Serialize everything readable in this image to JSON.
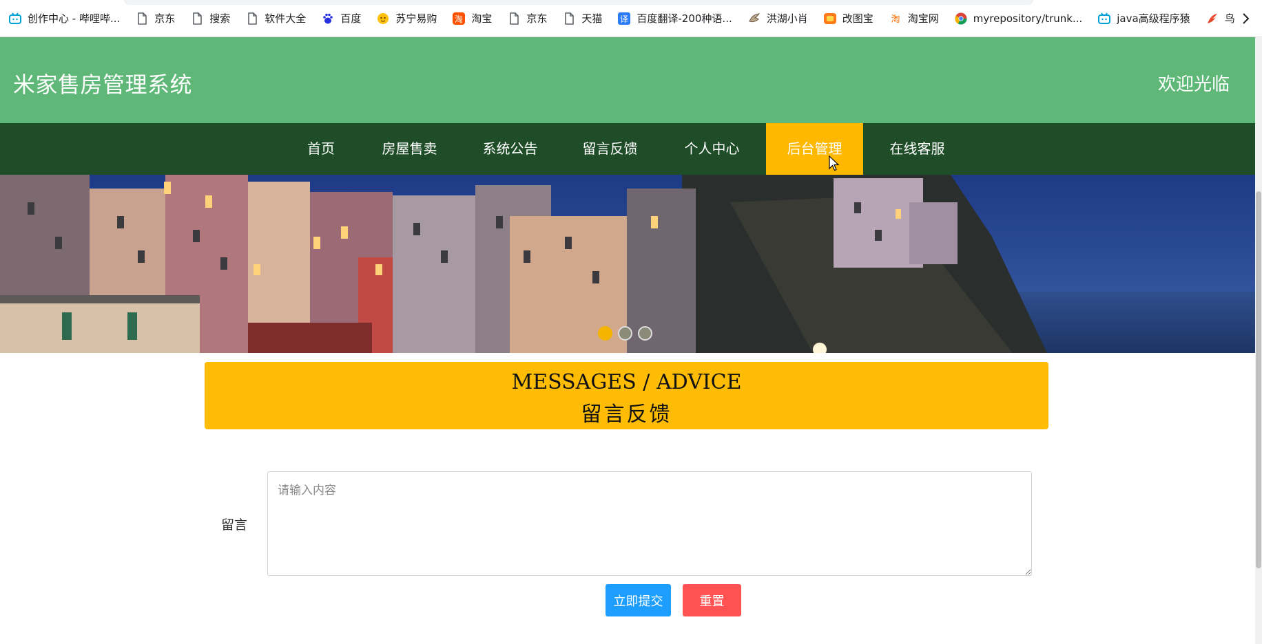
{
  "bookmarks": [
    {
      "label": "创作中心 - 哔哩哔...",
      "icon": "bilibili-icon"
    },
    {
      "label": "京东",
      "icon": "page-icon"
    },
    {
      "label": "搜索",
      "icon": "page-icon"
    },
    {
      "label": "软件大全",
      "icon": "page-icon"
    },
    {
      "label": "百度",
      "icon": "baidu-icon"
    },
    {
      "label": "苏宁易购",
      "icon": "suning-icon"
    },
    {
      "label": "淘宝",
      "icon": "taobao-icon"
    },
    {
      "label": "京东",
      "icon": "page-icon"
    },
    {
      "label": "天猫",
      "icon": "page-icon"
    },
    {
      "label": "百度翻译-200种语...",
      "icon": "translate-icon"
    },
    {
      "label": "洪湖小肖",
      "icon": "bird-icon"
    },
    {
      "label": "改图宝",
      "icon": "gaitubao-icon"
    },
    {
      "label": "淘宝网",
      "icon": "taobao-icon"
    },
    {
      "label": "myrepository/trunk...",
      "icon": "chrome-icon"
    },
    {
      "label": "java高级程序猿",
      "icon": "bilibili-icon"
    },
    {
      "label": "鸟",
      "icon": "feather-icon"
    }
  ],
  "header": {
    "title": "米家售房管理系统",
    "welcome": "欢迎光临"
  },
  "nav": [
    {
      "label": "首页",
      "active": false
    },
    {
      "label": "房屋售卖",
      "active": false
    },
    {
      "label": "系统公告",
      "active": false
    },
    {
      "label": "留言反馈",
      "active": false
    },
    {
      "label": "个人中心",
      "active": false
    },
    {
      "label": "后台管理",
      "active": true
    },
    {
      "label": "在线客服",
      "active": false
    }
  ],
  "banner": {
    "active_slide": 1,
    "slide_count": 3
  },
  "section": {
    "title_en": "MESSAGES / ADVICE",
    "title_cn": "留言反馈"
  },
  "form": {
    "label": "留言",
    "value": "",
    "placeholder": "请输入内容",
    "submit_label": "立即提交",
    "reset_label": "重置"
  },
  "colors": {
    "header": "#5fb878",
    "nav": "#1f4d28",
    "accent": "#ffb800",
    "submit": "#1e9fff",
    "reset": "#ff5252"
  }
}
